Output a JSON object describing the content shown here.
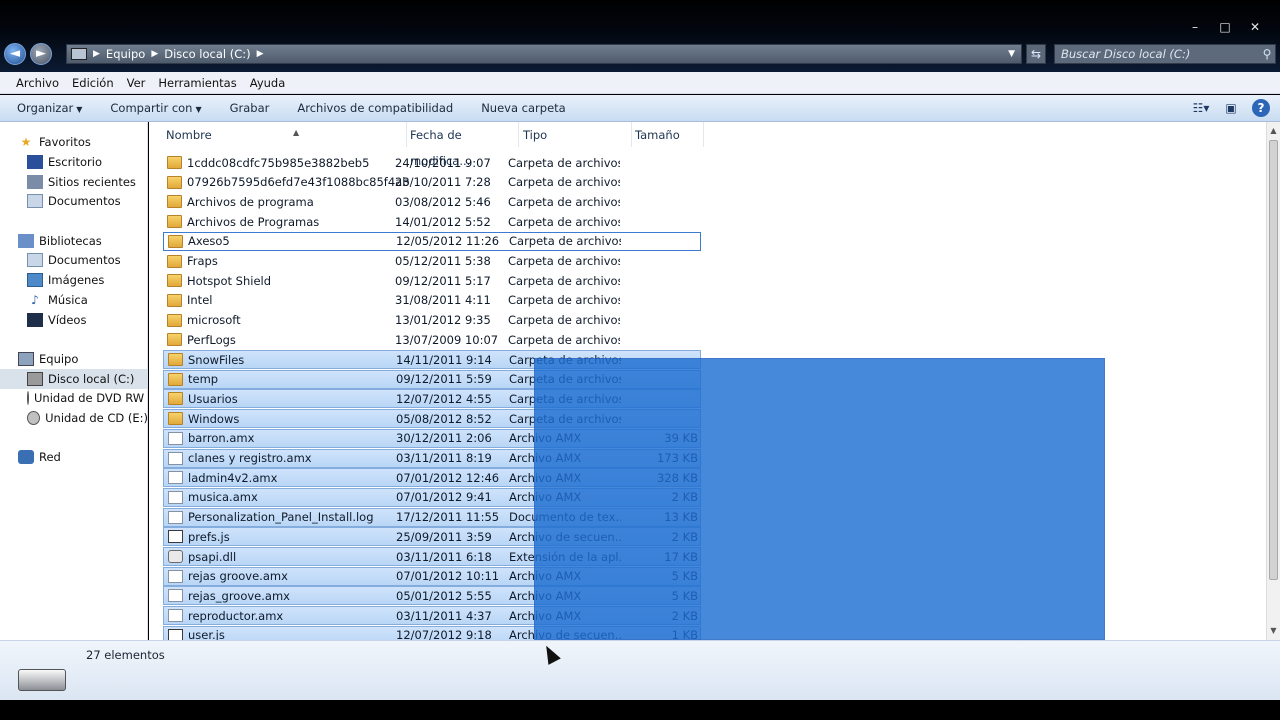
{
  "window": {
    "controls": [
      "–",
      "□",
      "✕"
    ]
  },
  "address": {
    "crumbs": [
      "Equipo",
      "Disco local (C:)"
    ]
  },
  "search": {
    "placeholder": "Buscar Disco local (C:)"
  },
  "menubar": {
    "items": [
      "Archivo",
      "Edición",
      "Ver",
      "Herramientas",
      "Ayuda"
    ]
  },
  "toolbar": {
    "organize": "Organizar",
    "share": "Compartir con",
    "burn": "Grabar",
    "compat": "Archivos de compatibilidad",
    "new_folder": "Nueva carpeta"
  },
  "nav": {
    "favorites": "Favoritos",
    "desktop": "Escritorio",
    "recent": "Sitios recientes",
    "documents_fav": "Documentos",
    "libraries": "Bibliotecas",
    "documents": "Documentos",
    "images": "Imágenes",
    "music": "Música",
    "videos": "Vídeos",
    "computer": "Equipo",
    "local_disk": "Disco local (C:)",
    "dvd": "Unidad de DVD RW (",
    "cd": "Unidad de CD (E:)",
    "network": "Red"
  },
  "columns": {
    "name": "Nombre",
    "date": "Fecha de modifica...",
    "type": "Tipo",
    "size": "Tamaño"
  },
  "files": [
    {
      "name": "1cddc08cdfc75b985e3882beb5",
      "date": "24/10/2011 9:07",
      "type": "Carpeta de archivos",
      "size": "",
      "icon": "folder"
    },
    {
      "name": "07926b7595d6efd7e43f1088bc85f4ab",
      "date": "23/10/2011 7:28",
      "type": "Carpeta de archivos",
      "size": "",
      "icon": "folder"
    },
    {
      "name": "Archivos de programa",
      "date": "03/08/2012 5:46",
      "type": "Carpeta de archivos",
      "size": "",
      "icon": "folder"
    },
    {
      "name": "Archivos de Programas",
      "date": "14/01/2012 5:52",
      "type": "Carpeta de archivos",
      "size": "",
      "icon": "folder"
    },
    {
      "name": "Axeso5",
      "date": "12/05/2012 11:26",
      "type": "Carpeta de archivos",
      "size": "",
      "icon": "folder"
    },
    {
      "name": "Fraps",
      "date": "05/12/2011 5:38",
      "type": "Carpeta de archivos",
      "size": "",
      "icon": "folder"
    },
    {
      "name": "Hotspot Shield",
      "date": "09/12/2011 5:17",
      "type": "Carpeta de archivos",
      "size": "",
      "icon": "folder"
    },
    {
      "name": "Intel",
      "date": "31/08/2011 4:11",
      "type": "Carpeta de archivos",
      "size": "",
      "icon": "folder"
    },
    {
      "name": "microsoft",
      "date": "13/01/2012 9:35",
      "type": "Carpeta de archivos",
      "size": "",
      "icon": "folder"
    },
    {
      "name": "PerfLogs",
      "date": "13/07/2009 10:07",
      "type": "Carpeta de archivos",
      "size": "",
      "icon": "folder"
    },
    {
      "name": "SnowFiles",
      "date": "14/11/2011 9:14",
      "type": "Carpeta de archivos",
      "size": "",
      "icon": "folder"
    },
    {
      "name": "temp",
      "date": "09/12/2011 5:59",
      "type": "Carpeta de archivos",
      "size": "",
      "icon": "folder"
    },
    {
      "name": "Usuarios",
      "date": "12/07/2012 4:55",
      "type": "Carpeta de archivos",
      "size": "",
      "icon": "folder"
    },
    {
      "name": "Windows",
      "date": "05/08/2012 8:52",
      "type": "Carpeta de archivos",
      "size": "",
      "icon": "folder"
    },
    {
      "name": "barron.amx",
      "date": "30/12/2011 2:06",
      "type": "Archivo AMX",
      "size": "39 KB",
      "icon": "file"
    },
    {
      "name": "clanes y registro.amx",
      "date": "03/11/2011 8:19",
      "type": "Archivo AMX",
      "size": "173 KB",
      "icon": "file"
    },
    {
      "name": "ladmin4v2.amx",
      "date": "07/01/2012 12:46",
      "type": "Archivo AMX",
      "size": "328 KB",
      "icon": "file"
    },
    {
      "name": "musica.amx",
      "date": "07/01/2012 9:41",
      "type": "Archivo AMX",
      "size": "2 KB",
      "icon": "file"
    },
    {
      "name": "Personalization_Panel_Install.log",
      "date": "17/12/2011 11:55",
      "type": "Documento de tex...",
      "size": "13 KB",
      "icon": "file"
    },
    {
      "name": "prefs.js",
      "date": "25/09/2011 3:59",
      "type": "Archivo de secuen...",
      "size": "2 KB",
      "icon": "script"
    },
    {
      "name": "psapi.dll",
      "date": "03/11/2011 6:18",
      "type": "Extensión de la apl...",
      "size": "17 KB",
      "icon": "gear"
    },
    {
      "name": "rejas groove.amx",
      "date": "07/01/2012 10:11",
      "type": "Archivo AMX",
      "size": "5 KB",
      "icon": "file"
    },
    {
      "name": "rejas_groove.amx",
      "date": "05/01/2012 5:55",
      "type": "Archivo AMX",
      "size": "5 KB",
      "icon": "file"
    },
    {
      "name": "reproductor.amx",
      "date": "03/11/2011 4:37",
      "type": "Archivo AMX",
      "size": "2 KB",
      "icon": "file"
    },
    {
      "name": "user.js",
      "date": "12/07/2012 9:18",
      "type": "Archivo de secuen...",
      "size": "1 KB",
      "icon": "script"
    }
  ],
  "selection": {
    "focused_index": 4,
    "selected_from": 10,
    "selected_to": 24,
    "selection_color": "#1e6ed2"
  },
  "details": {
    "count": "27 elementos"
  },
  "colors": {
    "accent": "#2b66b7",
    "folder": "#e2a83a"
  }
}
